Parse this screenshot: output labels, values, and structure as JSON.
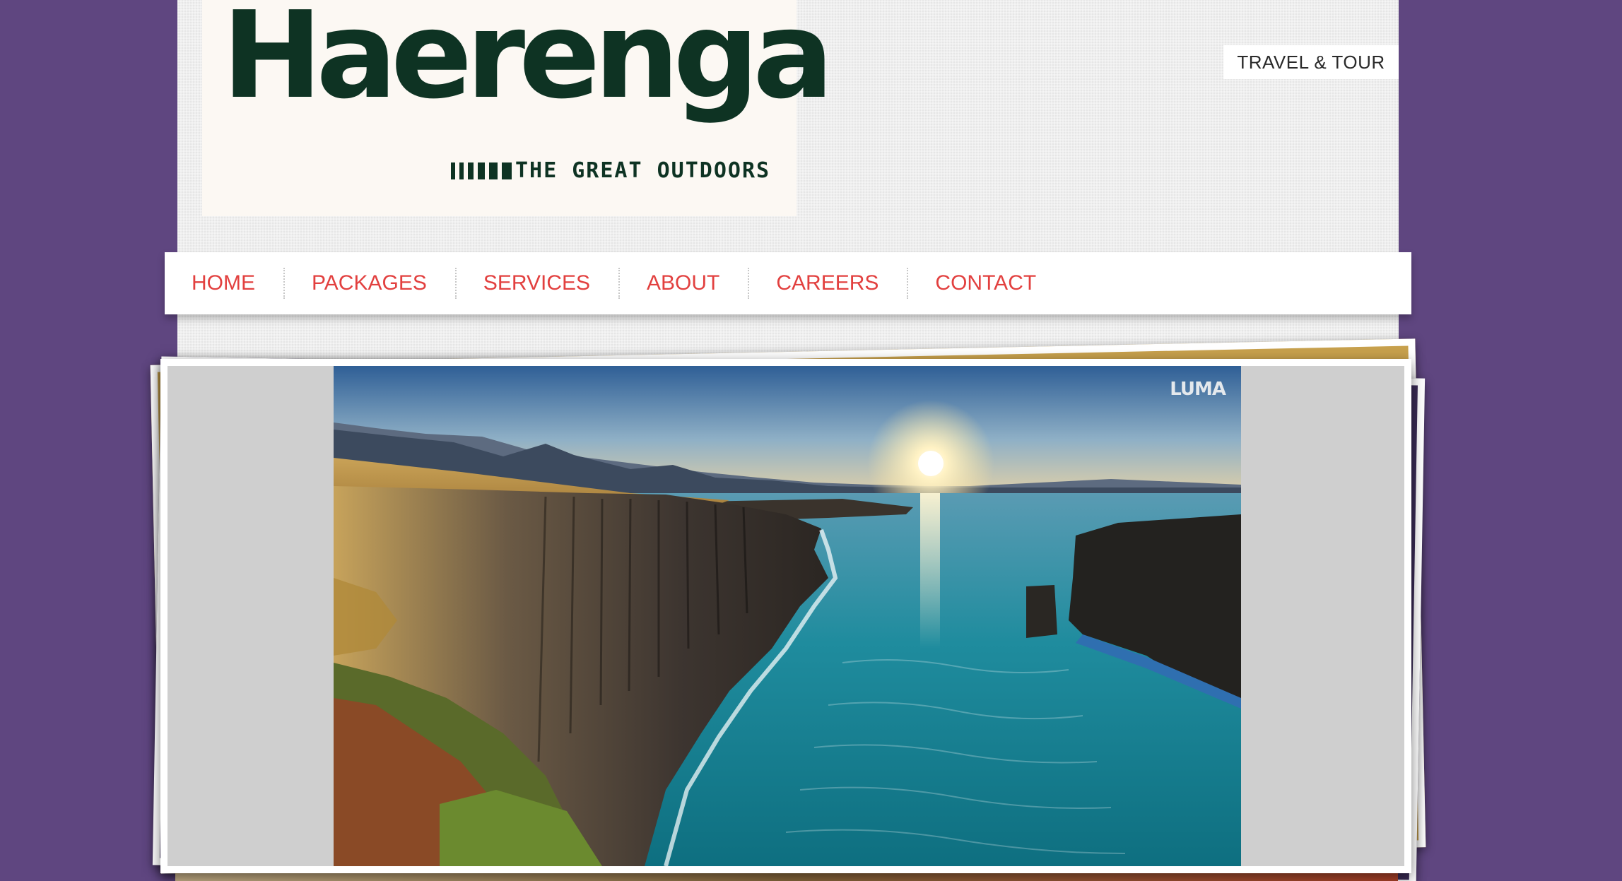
{
  "brand": {
    "name": "Haerenga",
    "tagline": "THE GREAT OUTDOORS",
    "color": "#0e3323"
  },
  "badge": {
    "label": "TRAVEL & TOUR"
  },
  "nav": {
    "items": [
      {
        "label": "HOME"
      },
      {
        "label": "PACKAGES"
      },
      {
        "label": "SERVICES"
      },
      {
        "label": "ABOUT"
      },
      {
        "label": "CAREERS"
      },
      {
        "label": "CONTACT"
      }
    ],
    "color": "#e2403f"
  },
  "slideshow": {
    "watermark": "LUMA"
  },
  "colors": {
    "background": "#5f4680",
    "page": "#e6e6e6"
  }
}
